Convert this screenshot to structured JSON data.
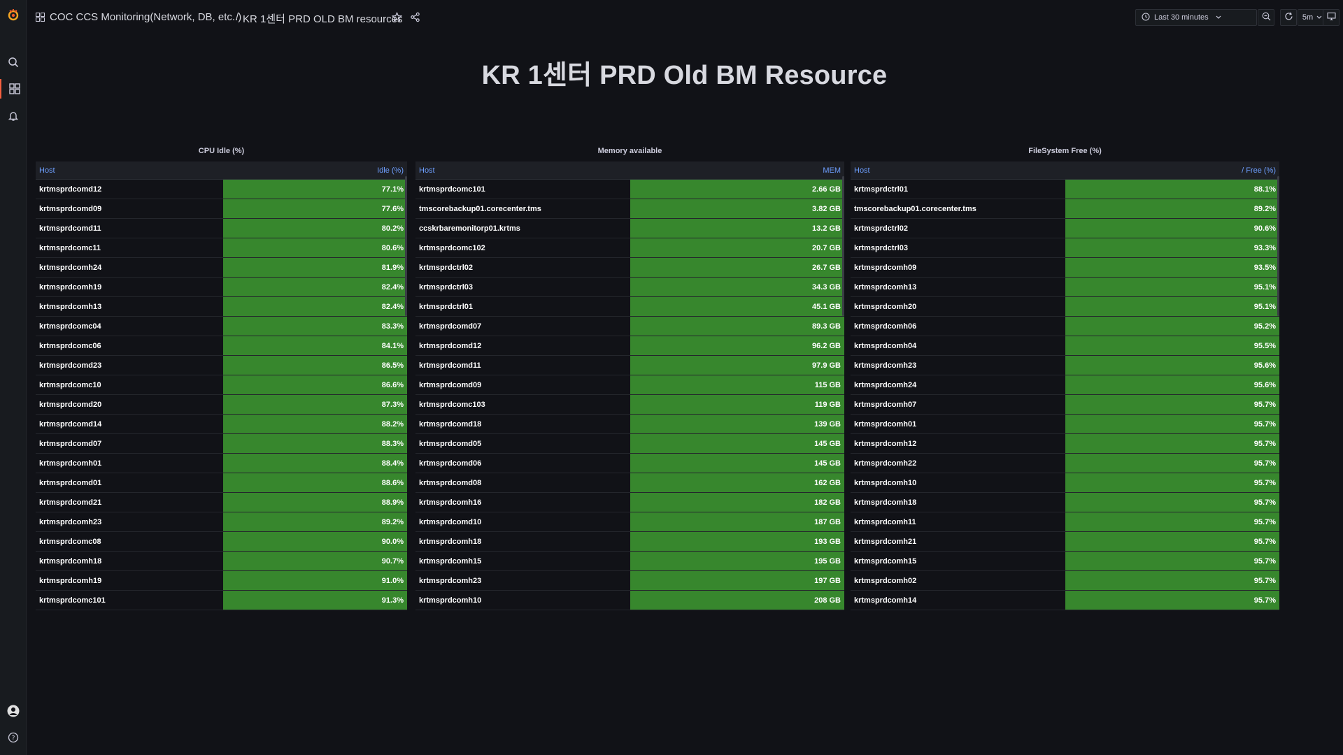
{
  "nav": {
    "breadcrumb_folder": "COC CCS Monitoring(Network, DB, etc..)",
    "breadcrumb_sep": "/",
    "breadcrumb_dashboard": "KR 1센터 PRD OLD BM resources",
    "time_range": "Last 30 minutes",
    "refresh_interval": "5m"
  },
  "dashboard": {
    "title": "KR 1센터 PRD Old BM Resource"
  },
  "colors": {
    "accent": "#f55f3e",
    "cell_green": "#37872d",
    "header_link": "#6e9fff"
  },
  "panels": [
    {
      "title": "CPU Idle (%)",
      "col_host": "Host",
      "col_value": "Idle (%)",
      "rows": [
        {
          "host": "krtmsprdcomd12",
          "value": "77.1%"
        },
        {
          "host": "krtmsprdcomd09",
          "value": "77.6%"
        },
        {
          "host": "krtmsprdcomd11",
          "value": "80.2%"
        },
        {
          "host": "krtmsprdcomc11",
          "value": "80.6%"
        },
        {
          "host": "krtmsprdcomh24",
          "value": "81.9%"
        },
        {
          "host": "krtmsprdcomh19",
          "value": "82.4%"
        },
        {
          "host": "krtmsprdcomh13",
          "value": "82.4%"
        },
        {
          "host": "krtmsprdcomc04",
          "value": "83.3%"
        },
        {
          "host": "krtmsprdcomc06",
          "value": "84.1%"
        },
        {
          "host": "krtmsprdcomd23",
          "value": "86.5%"
        },
        {
          "host": "krtmsprdcomc10",
          "value": "86.6%"
        },
        {
          "host": "krtmsprdcomd20",
          "value": "87.3%"
        },
        {
          "host": "krtmsprdcomd14",
          "value": "88.2%"
        },
        {
          "host": "krtmsprdcomd07",
          "value": "88.3%"
        },
        {
          "host": "krtmsprdcomh01",
          "value": "88.4%"
        },
        {
          "host": "krtmsprdcomd01",
          "value": "88.6%"
        },
        {
          "host": "krtmsprdcomd21",
          "value": "88.9%"
        },
        {
          "host": "krtmsprdcomh23",
          "value": "89.2%"
        },
        {
          "host": "krtmsprdcomc08",
          "value": "90.0%"
        },
        {
          "host": "krtmsprdcomh18",
          "value": "90.7%"
        },
        {
          "host": "krtmsprdcomh19",
          "value": "91.0%"
        },
        {
          "host": "krtmsprdcomc101",
          "value": "91.3%"
        }
      ]
    },
    {
      "title": "Memory available",
      "col_host": "Host",
      "col_value": "MEM",
      "rows": [
        {
          "host": "krtmsprdcomc101",
          "value": "2.66 GB"
        },
        {
          "host": "tmscorebackup01.corecenter.tms",
          "value": "3.82 GB"
        },
        {
          "host": "ccskrbaremonitorp01.krtms",
          "value": "13.2 GB"
        },
        {
          "host": "krtmsprdcomc102",
          "value": "20.7 GB"
        },
        {
          "host": "krtmsprdctrl02",
          "value": "26.7 GB"
        },
        {
          "host": "krtmsprdctrl03",
          "value": "34.3 GB"
        },
        {
          "host": "krtmsprdctrl01",
          "value": "45.1 GB"
        },
        {
          "host": "krtmsprdcomd07",
          "value": "89.3 GB"
        },
        {
          "host": "krtmsprdcomd12",
          "value": "96.2 GB"
        },
        {
          "host": "krtmsprdcomd11",
          "value": "97.9 GB"
        },
        {
          "host": "krtmsprdcomd09",
          "value": "115 GB"
        },
        {
          "host": "krtmsprdcomc103",
          "value": "119 GB"
        },
        {
          "host": "krtmsprdcomd18",
          "value": "139 GB"
        },
        {
          "host": "krtmsprdcomd05",
          "value": "145 GB"
        },
        {
          "host": "krtmsprdcomd06",
          "value": "145 GB"
        },
        {
          "host": "krtmsprdcomd08",
          "value": "162 GB"
        },
        {
          "host": "krtmsprdcomh16",
          "value": "182 GB"
        },
        {
          "host": "krtmsprdcomd10",
          "value": "187 GB"
        },
        {
          "host": "krtmsprdcomh18",
          "value": "193 GB"
        },
        {
          "host": "krtmsprdcomh15",
          "value": "195 GB"
        },
        {
          "host": "krtmsprdcomh23",
          "value": "197 GB"
        },
        {
          "host": "krtmsprdcomh10",
          "value": "208 GB"
        }
      ]
    },
    {
      "title": "FileSystem Free (%)",
      "col_host": "Host",
      "col_value": "/ Free (%)",
      "rows": [
        {
          "host": "krtmsprdctrl01",
          "value": "88.1%"
        },
        {
          "host": "tmscorebackup01.corecenter.tms",
          "value": "89.2%"
        },
        {
          "host": "krtmsprdctrl02",
          "value": "90.6%"
        },
        {
          "host": "krtmsprdctrl03",
          "value": "93.3%"
        },
        {
          "host": "krtmsprdcomh09",
          "value": "93.5%"
        },
        {
          "host": "krtmsprdcomh13",
          "value": "95.1%"
        },
        {
          "host": "krtmsprdcomh20",
          "value": "95.1%"
        },
        {
          "host": "krtmsprdcomh06",
          "value": "95.2%"
        },
        {
          "host": "krtmsprdcomh04",
          "value": "95.5%"
        },
        {
          "host": "krtmsprdcomh23",
          "value": "95.6%"
        },
        {
          "host": "krtmsprdcomh24",
          "value": "95.6%"
        },
        {
          "host": "krtmsprdcomh07",
          "value": "95.7%"
        },
        {
          "host": "krtmsprdcomh01",
          "value": "95.7%"
        },
        {
          "host": "krtmsprdcomh12",
          "value": "95.7%"
        },
        {
          "host": "krtmsprdcomh22",
          "value": "95.7%"
        },
        {
          "host": "krtmsprdcomh10",
          "value": "95.7%"
        },
        {
          "host": "krtmsprdcomh18",
          "value": "95.7%"
        },
        {
          "host": "krtmsprdcomh11",
          "value": "95.7%"
        },
        {
          "host": "krtmsprdcomh21",
          "value": "95.7%"
        },
        {
          "host": "krtmsprdcomh15",
          "value": "95.7%"
        },
        {
          "host": "krtmsprdcomh02",
          "value": "95.7%"
        },
        {
          "host": "krtmsprdcomh14",
          "value": "95.7%"
        }
      ]
    }
  ]
}
